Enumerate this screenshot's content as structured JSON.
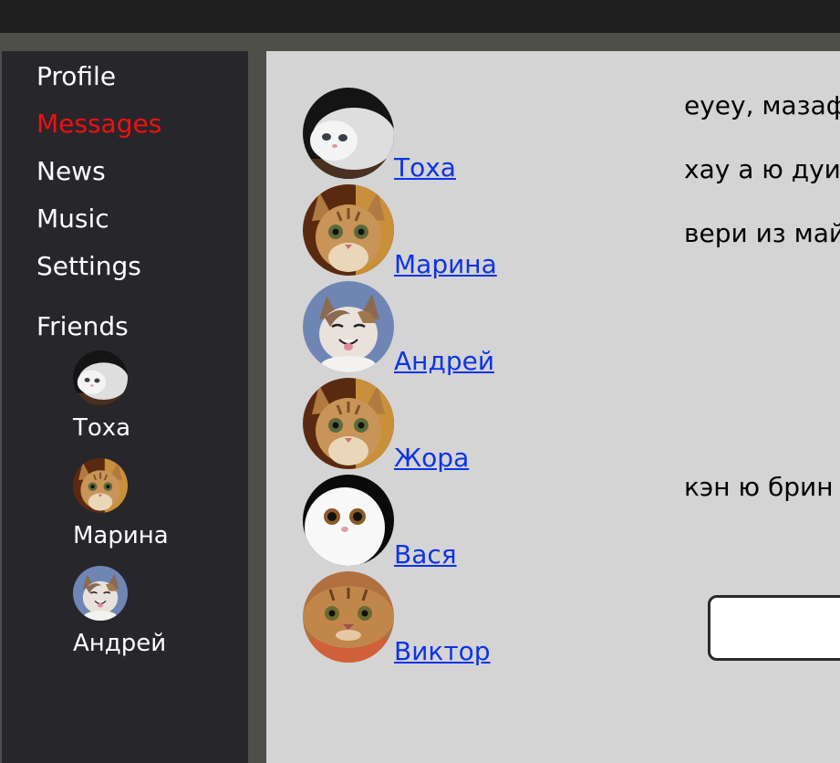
{
  "nav": {
    "items": [
      {
        "label": "Profile",
        "active": false
      },
      {
        "label": "Messages",
        "active": true
      },
      {
        "label": "News",
        "active": false
      },
      {
        "label": "Music",
        "active": false
      },
      {
        "label": "Settings",
        "active": false
      }
    ],
    "friends_title": "Friends",
    "friends": [
      {
        "name": "Тоха"
      },
      {
        "name": "Марина"
      },
      {
        "name": "Андрей"
      }
    ]
  },
  "dialogs": [
    {
      "name": "Тоха"
    },
    {
      "name": "Марина"
    },
    {
      "name": "Андрей"
    },
    {
      "name": "Жора"
    },
    {
      "name": "Вася"
    },
    {
      "name": "Виктор"
    }
  ],
  "messages": [
    {
      "text": "еуеу, мазаф"
    },
    {
      "text": "хау а ю дуи"
    },
    {
      "text": "вери из май"
    },
    {
      "text": "кэн ю брин"
    }
  ],
  "message_input": {
    "value": ""
  },
  "colors": {
    "active_nav": "#ee1111",
    "link": "#0d33e6"
  }
}
